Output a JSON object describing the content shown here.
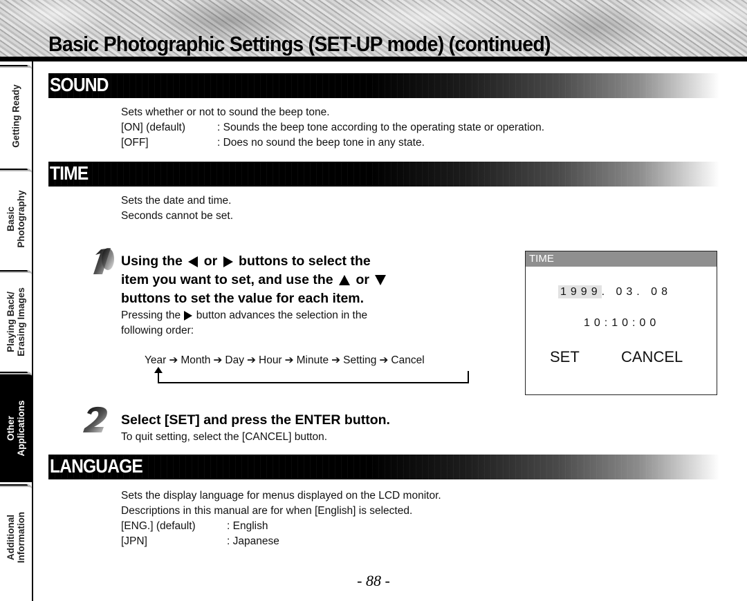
{
  "header": {
    "title": "Basic Photographic Settings (SET-UP mode) (continued)"
  },
  "sidebar": {
    "tabs": [
      {
        "label": "Getting Ready",
        "active": false
      },
      {
        "label": "Basic\nPhotography",
        "active": false
      },
      {
        "label": "Playing Back/\nErasing Images",
        "active": false
      },
      {
        "label": "Other\nApplications",
        "active": true
      },
      {
        "label": "Additional\nInformation",
        "active": false
      }
    ]
  },
  "sound": {
    "title": "SOUND",
    "description": "Sets whether or not to sound the beep tone.",
    "options": [
      {
        "key": "[ON] (default)",
        "value": ": Sounds the beep tone according to the operating state or operation."
      },
      {
        "key": "[OFF]",
        "value": ": Does no sound the beep tone in any state."
      }
    ]
  },
  "time": {
    "title": "TIME",
    "lines": [
      "Sets the date and time.",
      "Seconds cannot be set."
    ],
    "step1": {
      "number": "1",
      "head": {
        "p1": "Using the",
        "p2": "or",
        "p3": "buttons to select the",
        "p4": "item you want to set, and use the",
        "p5": "or",
        "p6": "buttons to set the value for each item."
      },
      "desc": {
        "p1": "Pressing the",
        "p2": "button advances the selection in the",
        "p3": "following order:"
      },
      "flow": [
        "Year",
        "Month",
        "Day",
        "Hour",
        "Minute",
        "Setting",
        "Cancel"
      ],
      "flow_arrow": "➔"
    },
    "step2": {
      "number": "2",
      "head": "Select [SET] and press the ENTER button.",
      "desc": "To quit setting, select the [CANCEL] button."
    },
    "lcd": {
      "title": "TIME",
      "year": "1999",
      "date_rest": ". 03. 08",
      "time": "10:10:00",
      "set_label": "SET",
      "cancel_label": "CANCEL"
    }
  },
  "language": {
    "title": "LANGUAGE",
    "lines": [
      "Sets the display language for menus displayed on the LCD monitor.",
      "Descriptions in this manual are for when [English] is selected."
    ],
    "options": [
      {
        "key": "[ENG.] (default)",
        "value": ": English"
      },
      {
        "key": "[JPN]",
        "value": ": Japanese"
      }
    ]
  },
  "footer": {
    "page_number": "- 88 -"
  }
}
